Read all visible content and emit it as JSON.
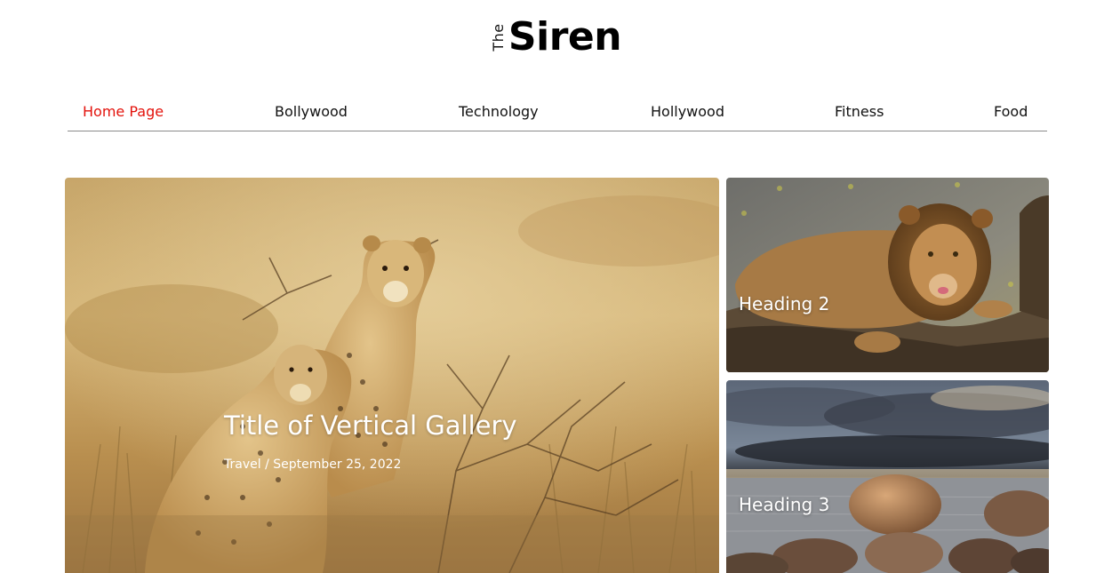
{
  "logo": {
    "prefix": "The",
    "name": "Siren"
  },
  "nav": {
    "items": [
      {
        "label": "Home Page",
        "active": true
      },
      {
        "label": "Bollywood",
        "active": false
      },
      {
        "label": "Technology",
        "active": false
      },
      {
        "label": "Hollywood",
        "active": false
      },
      {
        "label": "Fitness",
        "active": false
      },
      {
        "label": "Food",
        "active": false
      }
    ],
    "active_color": "#e3120b"
  },
  "featured": {
    "title": "Title of Vertical Gallery",
    "meta": "Travel / September 25, 2022",
    "image": "cheetahs-in-grass"
  },
  "cards": [
    {
      "heading": "Heading 2",
      "image": "lion-on-log"
    },
    {
      "heading": "Heading 3",
      "image": "rocky-shore-sunset"
    }
  ]
}
